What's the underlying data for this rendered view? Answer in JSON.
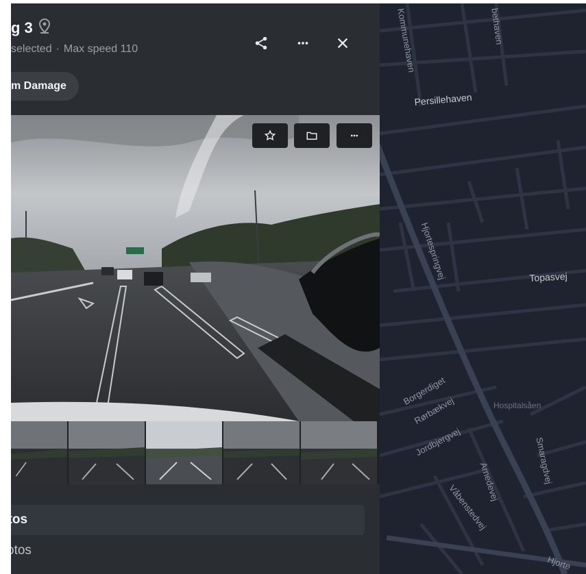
{
  "panel": {
    "title": "g 3",
    "subtitle_selected": "selected",
    "subtitle_separator": "·",
    "subtitle_speed": "Max speed 110",
    "chip_label": "m Damage",
    "header_actions": [
      "share-icon",
      "more-icon",
      "close-icon"
    ],
    "viewer_actions": [
      "star-icon",
      "folder-icon",
      "more-icon"
    ],
    "thumbnails_count_visible": 5,
    "selected_thumbnail": 3,
    "list": {
      "selected_item": "otos",
      "item": "otos"
    }
  },
  "map": {
    "streets": {
      "kommunehaven": "Kommunehaven",
      "bethaven": "bethaven",
      "persillehaven": "Persillehaven",
      "hjortespringvej": "Hjortespringvej",
      "topasvej": "Topasvej",
      "borgerdiget": "Borgerdiget",
      "rorbaekvej": "Rørbækvej",
      "hospitalsaaen": "Hospitalsåen",
      "jordbjergvej": "Jordbjergvej",
      "arnedevej": "Arnedevej",
      "smaragdvej": "Smaragdvej",
      "vabenstedvej": "Våbenstedvej",
      "hjorte_partial": "Hjorte"
    }
  },
  "colors": {
    "panel_bg": "#2a2d31",
    "map_bg": "#1f2330",
    "chip_bg": "#3b3f44",
    "selected_row_bg": "#33383e"
  }
}
